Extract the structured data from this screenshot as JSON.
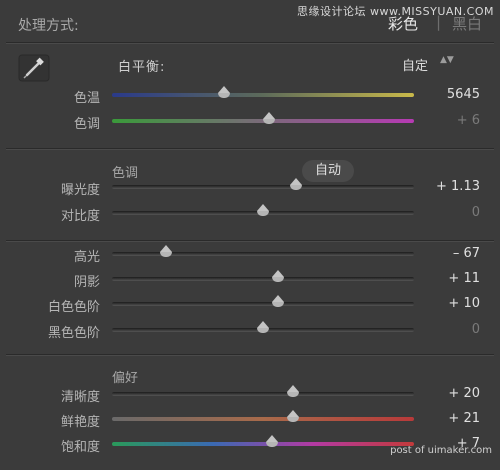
{
  "header": {
    "title": "处理方式:",
    "mode_color": "彩色",
    "mode_separator": "|",
    "mode_bw": "黑白"
  },
  "watermarks": {
    "top": "思缘设计论坛 www.MISSYUAN.COM",
    "bottom": "post of uimaker.com"
  },
  "white_balance": {
    "label": "白平衡:",
    "value": "自定",
    "arrows": "▲▼"
  },
  "tone": {
    "label": "色调",
    "auto_label": "自动"
  },
  "presence": {
    "label": "偏好"
  },
  "sliders": [
    {
      "id": "temp",
      "label": "色温",
      "value": "5645",
      "dim": false,
      "pos": 0.37
    },
    {
      "id": "tint",
      "label": "色调",
      "value": "+ 6",
      "dim": true,
      "pos": 0.52
    },
    {
      "id": "exposure",
      "label": "曝光度",
      "value": "+ 1.13",
      "dim": false,
      "pos": 0.61
    },
    {
      "id": "contrast",
      "label": "对比度",
      "value": "0",
      "dim": true,
      "pos": 0.5
    },
    {
      "id": "highlights",
      "label": "高光",
      "value": "– 67",
      "dim": false,
      "pos": 0.18
    },
    {
      "id": "shadows",
      "label": "阴影",
      "value": "+ 11",
      "dim": false,
      "pos": 0.55
    },
    {
      "id": "whites",
      "label": "白色色阶",
      "value": "+ 10",
      "dim": false,
      "pos": 0.55
    },
    {
      "id": "blacks",
      "label": "黑色色阶",
      "value": "0",
      "dim": true,
      "pos": 0.5
    },
    {
      "id": "clarity",
      "label": "清晰度",
      "value": "+ 20",
      "dim": false,
      "pos": 0.6
    },
    {
      "id": "vibrance",
      "label": "鲜艳度",
      "value": "+ 21",
      "dim": false,
      "pos": 0.6
    },
    {
      "id": "saturation",
      "label": "饱和度",
      "value": "+ 7",
      "dim": false,
      "pos": 0.53
    }
  ]
}
